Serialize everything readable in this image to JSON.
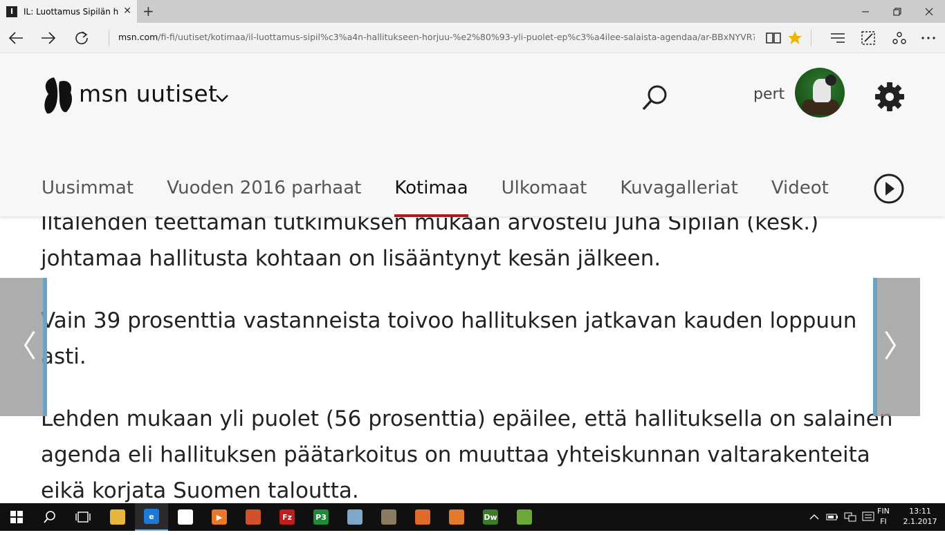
{
  "browser": {
    "tab_title": "IL: Luottamus Sipilän ha",
    "tab_close": "✕",
    "new_tab": "+",
    "url_host": "msn.com",
    "url_path": "/fi-fi/uutiset/kotimaa/il-luottamus-sipil%c3%a4n-hallitukseen-horjuu-%e2%80%93-yli-puolet-ep%c3%a4ilee-salaista-agendaa/ar-BBxNYVR?li=AAaDcIL"
  },
  "header": {
    "brand": "msn uutiset",
    "user_name": "pert",
    "nav_tabs": [
      {
        "label": "Uusimmat"
      },
      {
        "label": "Vuoden 2016 parhaat"
      },
      {
        "label": "Kotimaa"
      },
      {
        "label": "Ulkomaat"
      },
      {
        "label": "Kuvagalleriat"
      },
      {
        "label": "Videot"
      }
    ],
    "active_tab": "Kotimaa"
  },
  "article": {
    "paragraphs": [
      "Iltalehden teettämän tutkimuksen mukaan arvostelu Juha Sipilän (kesk.) johtamaa hallitusta kohtaan on lisääntynyt kesän jälkeen.",
      "Vain 39 prosenttia vastanneista toivoo hallituksen jatkavan kauden loppuun asti.",
      "Lehden mukaan yli puolet (56 prosenttia) epäilee, että hallituksella on salainen agenda eli hallituksen päätarkoitus on muuttaa yhteiskunnan valtarakenteita eikä korjata Suomen taloutta."
    ]
  },
  "carousel": {
    "prev_glyph": "〈",
    "next_glyph": "〉"
  },
  "taskbar": {
    "apps": [
      {
        "name": "file-explorer",
        "label": "",
        "color": "#e8b53c"
      },
      {
        "name": "edge",
        "label": "e",
        "color": "#1e78d6"
      },
      {
        "name": "store",
        "label": "",
        "color": "#ffffff"
      },
      {
        "name": "media-player",
        "label": "▶",
        "color": "#e8792a"
      },
      {
        "name": "paint-app",
        "label": "",
        "color": "#d2502a"
      },
      {
        "name": "filezilla",
        "label": "Fz",
        "color": "#bf1e1e"
      },
      {
        "name": "p3-app",
        "label": "P3",
        "color": "#1e8a3a"
      },
      {
        "name": "notepad-app",
        "label": "",
        "color": "#7fa7c9"
      },
      {
        "name": "gimp-app",
        "label": "",
        "color": "#8a7b63"
      },
      {
        "name": "eye-app",
        "label": "",
        "color": "#e06a2a"
      },
      {
        "name": "html-app",
        "label": "",
        "color": "#e07a2a"
      },
      {
        "name": "dreamweaver",
        "label": "Dw",
        "color": "#3d7a2a"
      },
      {
        "name": "spreadsheet-app",
        "label": "",
        "color": "#6aa83a"
      }
    ],
    "lang_line1": "FIN",
    "lang_line2": "FI",
    "time": "13:11",
    "date": "2.1.2017"
  }
}
